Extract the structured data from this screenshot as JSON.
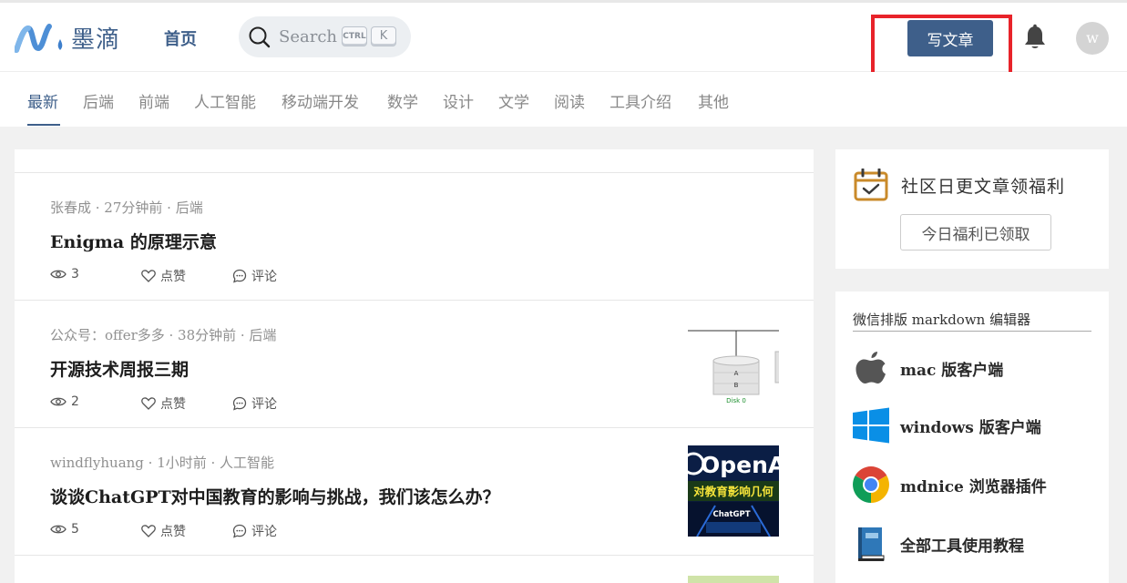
{
  "header": {
    "logo_text": "墨滴",
    "home": "首页",
    "search_placeholder": "Search",
    "kbd_ctrl": "CTRL",
    "kbd_k": "K",
    "write_button": "写文章",
    "avatar_letter": "w"
  },
  "categories": [
    "最新",
    "后端",
    "前端",
    "人工智能",
    "移动端开发",
    "数学",
    "设计",
    "文学",
    "阅读",
    "工具介绍",
    "其他"
  ],
  "articles": [
    {
      "meta": "张春成 · 27分钟前 · 后端",
      "title": "Enigma 的原理示意",
      "views": "3",
      "like": "点赞",
      "comment": "评论"
    },
    {
      "meta": "公众号：offer多多 · 38分钟前 · 后端",
      "title": "开源技术周报三期",
      "views": "2",
      "like": "点赞",
      "comment": "评论",
      "thumb": {
        "disk_a": "A",
        "disk_b": "B",
        "disk_label": "Disk 0"
      }
    },
    {
      "meta": "windflyhuang · 1小时前 · 人工智能",
      "title": "谈谈ChatGPT对中国教育的影响与挑战，我们该怎么办？",
      "views": "5",
      "like": "点赞",
      "comment": "评论",
      "thumb": {
        "top": "OpenA",
        "mid": "对教育影响几何",
        "bottom": "ChatGPT"
      }
    }
  ],
  "sidebar": {
    "checkin_title": "社区日更文章领福利",
    "checkin_button": "今日福利已领取",
    "tools_header": "微信排版 markdown 编辑器",
    "tools": [
      {
        "icon": "apple-icon",
        "label": "mac 版客户端"
      },
      {
        "icon": "windows-icon",
        "label": "windows 版客户端"
      },
      {
        "icon": "chrome-icon",
        "label": "mdnice 浏览器插件"
      },
      {
        "icon": "book-icon",
        "label": "全部工具使用教程"
      }
    ]
  },
  "colors": {
    "brand": "#3e5f8a",
    "highlight": "#e8232a"
  }
}
